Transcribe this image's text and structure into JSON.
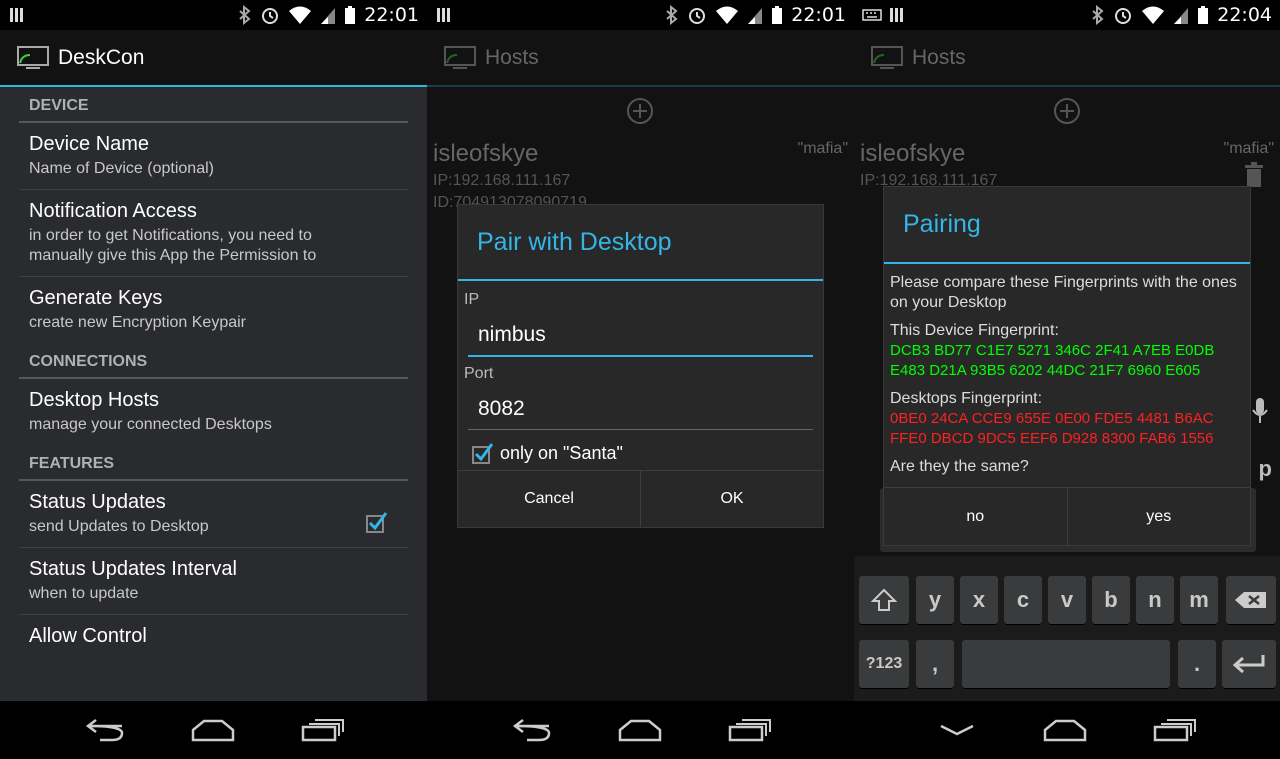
{
  "status1": {
    "time": "22:01"
  },
  "status2": {
    "time": "22:01"
  },
  "status3": {
    "time": "22:04"
  },
  "settings": {
    "app_title": "DeskCon",
    "cat_device": "DEVICE",
    "device_name": {
      "title": "Device Name",
      "summary": "Name of Device (optional)"
    },
    "notification": {
      "title": "Notification Access",
      "summary": "in order to get Notifications, you need to manually give this App the Permission to"
    },
    "keys": {
      "title": "Generate Keys",
      "summary": "create new Encryption Keypair"
    },
    "cat_connections": "CONNECTIONS",
    "hosts": {
      "title": "Desktop Hosts",
      "summary": "manage your connected Desktops"
    },
    "cat_features": "FEATURES",
    "status_updates": {
      "title": "Status Updates",
      "summary": "send Updates to Desktop",
      "checked": true
    },
    "interval": {
      "title": "Status Updates Interval",
      "summary": "when to update"
    },
    "allow_control": {
      "title": "Allow Control"
    }
  },
  "hosts_screen": {
    "title": "Hosts",
    "host_name": "isleofskye",
    "host_ip": "IP:192.168.111.167",
    "host_id": "ID:704913078090719",
    "host_tag": "\"mafia\""
  },
  "pair_dialog": {
    "title": "Pair with Desktop",
    "ip_label": "IP",
    "ip_value": "nimbus",
    "port_label": "Port",
    "port_value": "8082",
    "only_on": "only on \"Santa\"",
    "cancel": "Cancel",
    "ok": "OK"
  },
  "pairing_dialog": {
    "title": "Pairing",
    "intro": "Please compare these Fingerprints with the ones on your Desktop",
    "device_fp_label": "This Device Fingerprint:",
    "device_fp": "DCB3 BD77 C1E7 5271 346C 2F41 A7EB E0DB E483 D21A 93B5 6202 44DC 21F7 6960 E605",
    "desktop_fp_label": "Desktops Fingerprint:",
    "desktop_fp": "0BE0 24CA CCE9 655E 0E00 FDE5 4481 B6AC FFE0 DBCD 9DC5 EEF6 D928 8300 FAB6 1556",
    "question": "Are they the same?",
    "no": "no",
    "yes": "yes"
  },
  "keyboard": {
    "row2": [
      "y",
      "x",
      "c",
      "v",
      "b",
      "n",
      "m"
    ],
    "sym": "?123",
    "comma": ",",
    "period": ".",
    "partial_p": "p"
  },
  "colors": {
    "accent": "#33b5e5",
    "fp_green": "#00ff00",
    "fp_red": "#ff2020"
  }
}
